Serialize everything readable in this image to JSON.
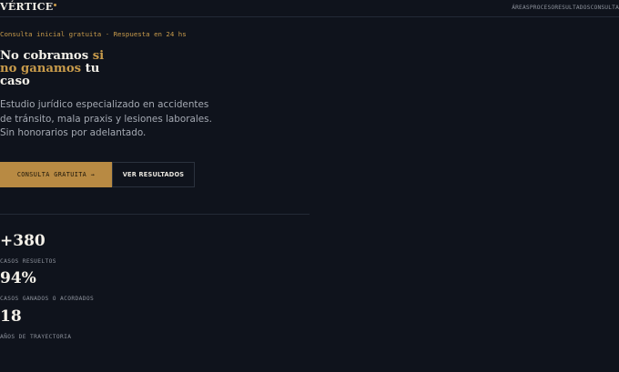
{
  "nav": {
    "brand": "VÉRTICE",
    "links": [
      "ÁREAS",
      "PROCESO",
      "RESULTADOS",
      "CONSULTA"
    ]
  },
  "hero": {
    "eyebrow": "Consulta inicial gratuita · Respuesta en 24 hs",
    "headline_part1": "No cobramos ",
    "headline_accent": "si no ganamos",
    "headline_part2": " tu caso",
    "lede": "Estudio jurídico especializado en accidentes de tránsito, mala praxis y lesiones laborales. Sin honorarios por adelantado.",
    "primary_cta": "CONSULTA GRATUITA →",
    "secondary_cta": "VER RESULTADOS"
  },
  "stats": [
    {
      "value": "+380",
      "label": "CASOS RESUELTOS"
    },
    {
      "value": "94%",
      "label": "CASOS GANADOS O ACORDADOS"
    },
    {
      "value": "18",
      "label": "AÑOS DE TRAYECTORIA"
    }
  ],
  "colors": {
    "background": "#0f131c",
    "accent": "#c89b4b",
    "button": "#b88a43"
  }
}
